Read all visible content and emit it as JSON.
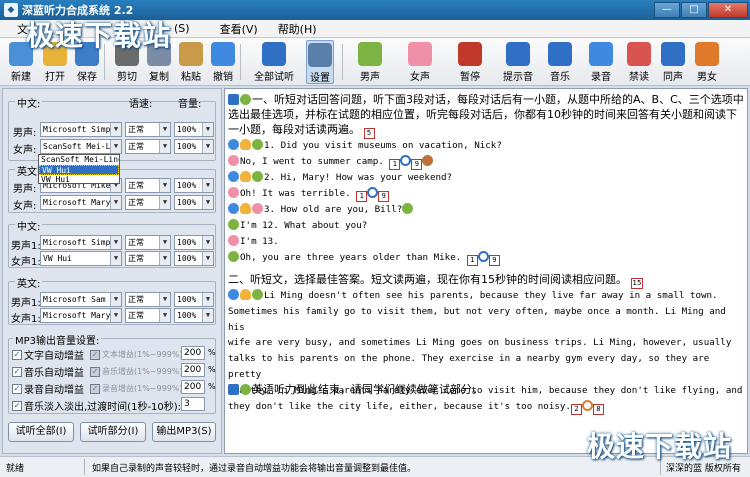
{
  "window": {
    "title": "深蓝听力合成系统 2.2",
    "controls": [
      "—",
      "□",
      "✕"
    ]
  },
  "watermark": "极速下载站",
  "menu": [
    "文",
    "(S)",
    "查看(V)",
    "帮助(H)"
  ],
  "toolbar": [
    {
      "label": "新建",
      "icon": "new-icon",
      "color": "#4a8fd8"
    },
    {
      "label": "打开",
      "icon": "open-icon",
      "color": "#e8b23a"
    },
    {
      "label": "保存",
      "icon": "save-icon",
      "color": "#3d7cc9"
    },
    {
      "label": "剪切",
      "icon": "cut-icon",
      "color": "#6b6b6b"
    },
    {
      "label": "复制",
      "icon": "copy-icon",
      "color": "#7a8ca6"
    },
    {
      "label": "粘贴",
      "icon": "paste-icon",
      "color": "#c99a4a"
    },
    {
      "label": "撤销",
      "icon": "undo-icon",
      "color": "#3f8ae0"
    },
    {
      "label": "全部试听",
      "icon": "play-icon",
      "color": "#2f6fc4"
    },
    {
      "label": "设置",
      "icon": "gear-icon",
      "color": "#5a7fa8"
    },
    {
      "label": "男声",
      "icon": "male-voice-icon",
      "color": "#7cb342"
    },
    {
      "label": "女声",
      "icon": "female-voice-icon",
      "color": "#ef8fa8"
    },
    {
      "label": "暂停",
      "icon": "pause-icon",
      "color": "#c0392b"
    },
    {
      "label": "提示音",
      "icon": "bell-icon",
      "color": "#2f6fc4"
    },
    {
      "label": "音乐",
      "icon": "music-icon",
      "color": "#2f6fc4"
    },
    {
      "label": "录音",
      "icon": "mic-icon",
      "color": "#3f8ae0"
    },
    {
      "label": "禁读",
      "icon": "forbid-icon",
      "color": "#d9534f"
    },
    {
      "label": "同声",
      "icon": "sync-icon",
      "color": "#2f6fc4"
    },
    {
      "label": "男女",
      "icon": "male-female-icon",
      "color": "#e07a2a"
    }
  ],
  "left": {
    "section1": {
      "lang": "中文:",
      "speed_header": "语速:",
      "volume_header": "音量:",
      "rows": [
        {
          "label": "男声:",
          "voice": "Microsoft Simp",
          "speed": "正常",
          "volume": "100%"
        },
        {
          "label": "女声:",
          "voice": "ScanSoft Mei-L",
          "speed": "正常",
          "volume": "100%"
        }
      ]
    },
    "dropdown_options": [
      "ScanSoft Mei-Ling",
      "VW Hui",
      "VW Hui"
    ],
    "section2": {
      "lang": "英文:",
      "rows": [
        {
          "label": "男声:",
          "voice": "Microsoft Mike",
          "speed": "正常",
          "volume": "100%"
        },
        {
          "label": "女声:",
          "voice": "Microsoft Mary",
          "speed": "正常",
          "volume": "100%"
        }
      ]
    },
    "section3": {
      "lang": "中文:",
      "rows": [
        {
          "label": "男声1:",
          "voice": "Microsoft Simp",
          "speed": "正常",
          "volume": "100%"
        },
        {
          "label": "女声1:",
          "voice": "VW Hui",
          "speed": "正常",
          "volume": "100%"
        }
      ]
    },
    "section4": {
      "lang": "英文:",
      "rows": [
        {
          "label": "男声1:",
          "voice": "Microsoft Sam",
          "speed": "正常",
          "volume": "100%"
        },
        {
          "label": "女声1:",
          "voice": "Microsoft Mary",
          "speed": "正常",
          "volume": "100%"
        }
      ]
    },
    "mp3": {
      "title": "MP3输出音量设置:",
      "rows": [
        {
          "left": "文字自动增益",
          "right": "文本增益(1%~999%)",
          "value": "200",
          "unit": "%"
        },
        {
          "left": "音乐自动增益",
          "right": "音乐增益(1%~999%)",
          "value": "200",
          "unit": "%"
        },
        {
          "left": "录音自动增益",
          "right": "录音增益(1%~999%)",
          "value": "200",
          "unit": "%"
        }
      ],
      "fade_label": "音乐淡入淡出,过渡时间(1秒-10秒):",
      "fade_value": "3"
    },
    "buttons": [
      "试听全部(I)",
      "试听部分(I)",
      "输出MP3(S)"
    ]
  },
  "editor": {
    "section1_title": "一、听短对话回答问题，听下面3段对话，每段对话后有一小题，从题中所给的A、B、C、三个选项中选出最佳选项，并标在试题的相应位置，听完每段对话后，你都有10秒钟的时间来回答有关小题和阅读下一小题，每段对话读两遍。",
    "section1_badge": "5",
    "lines": [
      "1. Did you visit museums on vacation, Nick?",
      "No, I went to summer camp.",
      "2. Hi, Mary! How was your weekend?",
      "Oh! It was terrible.",
      "3. How old are you, Bill?",
      "I'm 12. What about you?",
      "I'm 13.",
      "Oh, you are three years older than Mike."
    ],
    "badges": {
      "b1a": "1",
      "b1b": "9",
      "b2a": "1",
      "b2b": "9",
      "b3a": "1",
      "b3b": "9"
    },
    "section2_title": "二、听短文，选择最佳答案。短文读两遍，现在你有15秒钟的时间阅读相应问题。",
    "section2_badge": "15",
    "passage": [
      "Li Ming doesn't often see his parents, because they live far away in a small town.",
      "Sometimes his family go to visit them, but not very often, maybe once a month.  Li Ming and his",
      "wife are very busy, and sometimes Li Ming goes on business trips.  Li Ming, however, usually",
      "talks to his parents on the phone.  They exercise in a nearby gym every day, so they are pretty",
      "healthy.  Li Ming's parents hardly ever come to visit him, because they don't like flying, and",
      "they don't like the city life, either, because it's too noisy."
    ],
    "passage_badges": {
      "a": "2",
      "b": "8"
    },
    "ending": "英语听力到此结束，请同学们继续做笔试部分。"
  },
  "status": {
    "left": "就绪",
    "tip": "如果自己录制的声音较轻时，通过录音自动增益功能会将输出音量调整到最佳值。",
    "copyright": "深深的蓝 版权所有"
  }
}
